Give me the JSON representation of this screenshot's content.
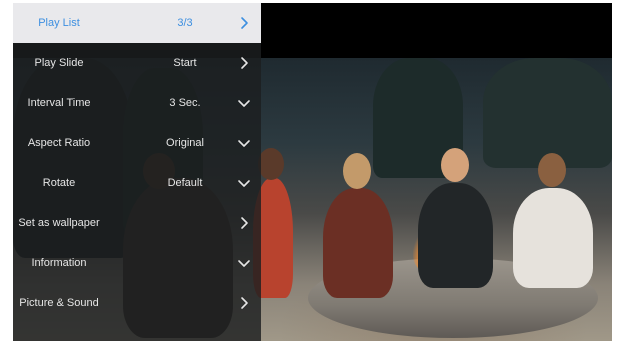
{
  "colors": {
    "active_text": "#3d8fe0",
    "active_bg": "#e9e9ec",
    "menu_text": "#e6e6e6",
    "menu_bg": "#1c1e20"
  },
  "menu": {
    "items": [
      {
        "label": "Play List",
        "value": "3/3",
        "icon": "chevron-right-icon",
        "active": true
      },
      {
        "label": "Play Slide",
        "value": "Start",
        "icon": "chevron-right-icon",
        "active": false
      },
      {
        "label": "Interval Time",
        "value": "3 Sec.",
        "icon": "chevron-down-icon",
        "active": false
      },
      {
        "label": "Aspect Ratio",
        "value": "Original",
        "icon": "chevron-down-icon",
        "active": false
      },
      {
        "label": "Rotate",
        "value": "Default",
        "icon": "chevron-down-icon",
        "active": false
      },
      {
        "label": "Set as wallpaper",
        "value": "",
        "icon": "chevron-right-icon",
        "active": false
      },
      {
        "label": "Information",
        "value": "",
        "icon": "chevron-down-icon",
        "active": false
      },
      {
        "label": "Picture & Sound",
        "value": "",
        "icon": "chevron-right-icon",
        "active": false
      }
    ]
  }
}
